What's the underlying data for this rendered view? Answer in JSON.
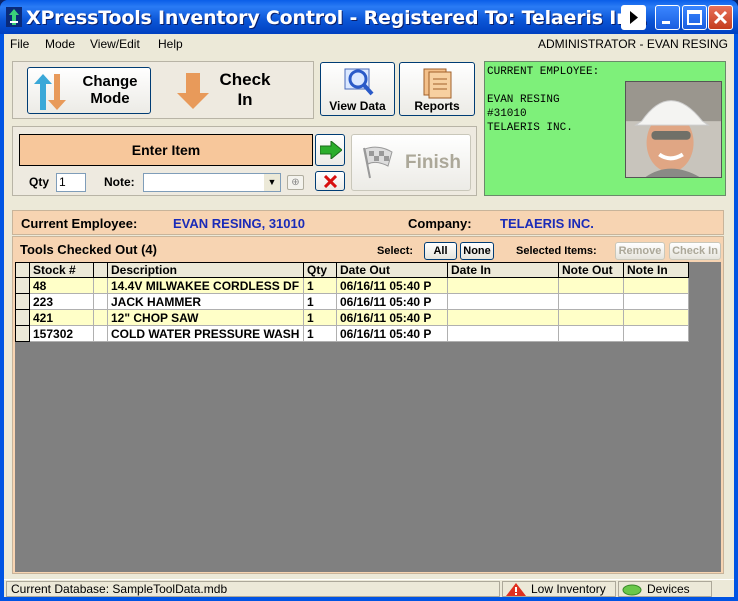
{
  "window": {
    "title": "XPressTools Inventory Control - Registered To: Telaeris Inc."
  },
  "menu": {
    "items": [
      "File",
      "Mode",
      "View/Edit",
      "Help"
    ],
    "user": "ADMINISTRATOR - EVAN RESING"
  },
  "toolbar": {
    "change_mode_line1": "Change",
    "change_mode_line2": "Mode",
    "check_in_line1": "Check",
    "check_in_line2": "In",
    "view_data": "View Data",
    "reports": "Reports"
  },
  "employee_card": {
    "header": "CURRENT EMPLOYEE:",
    "name": "EVAN RESING",
    "id": "#31010",
    "company": "TELAERIS INC."
  },
  "entry": {
    "enter_item": "Enter Item",
    "qty_label": "Qty",
    "qty_value": "1",
    "note_label": "Note:",
    "note_value": "",
    "finish": "Finish"
  },
  "info": {
    "employee_label": "Current Employee:",
    "employee_value": "EVAN RESING, 31010",
    "company_label": "Company:",
    "company_value": "TELAERIS INC."
  },
  "tools": {
    "title": "Tools Checked Out (4)",
    "select_label": "Select:",
    "all": "All",
    "none": "None",
    "selected_items_label": "Selected Items:",
    "remove": "Remove",
    "check_in": "Check In",
    "columns": [
      "Stock #",
      "",
      "Description",
      "Qty",
      "Date Out",
      "Date In",
      "Note Out",
      "Note In"
    ],
    "rows": [
      [
        "48",
        "",
        "14.4V MILWAKEE CORDLESS DF",
        "1",
        "06/16/11   05:40 P",
        "",
        "",
        ""
      ],
      [
        "223",
        "",
        "JACK HAMMER",
        "1",
        "06/16/11   05:40 P",
        "",
        "",
        ""
      ],
      [
        "421",
        "",
        "12\" CHOP SAW",
        "1",
        "06/16/11   05:40 P",
        "",
        "",
        ""
      ],
      [
        "157302",
        "",
        "COLD WATER PRESSURE WASH",
        "1",
        "06/16/11   05:40 P",
        "",
        "",
        ""
      ]
    ]
  },
  "status": {
    "database": "Current Database: SampleToolData.mdb",
    "low_inventory": "Low Inventory",
    "devices": "Devices"
  },
  "colors": {
    "title_blue": "#0054e3",
    "enter_item_bg": "#f7c79b",
    "panel_peach": "#f7d4b2",
    "employee_card_green": "#7ef07a",
    "value_blue": "#1a2bb8"
  }
}
